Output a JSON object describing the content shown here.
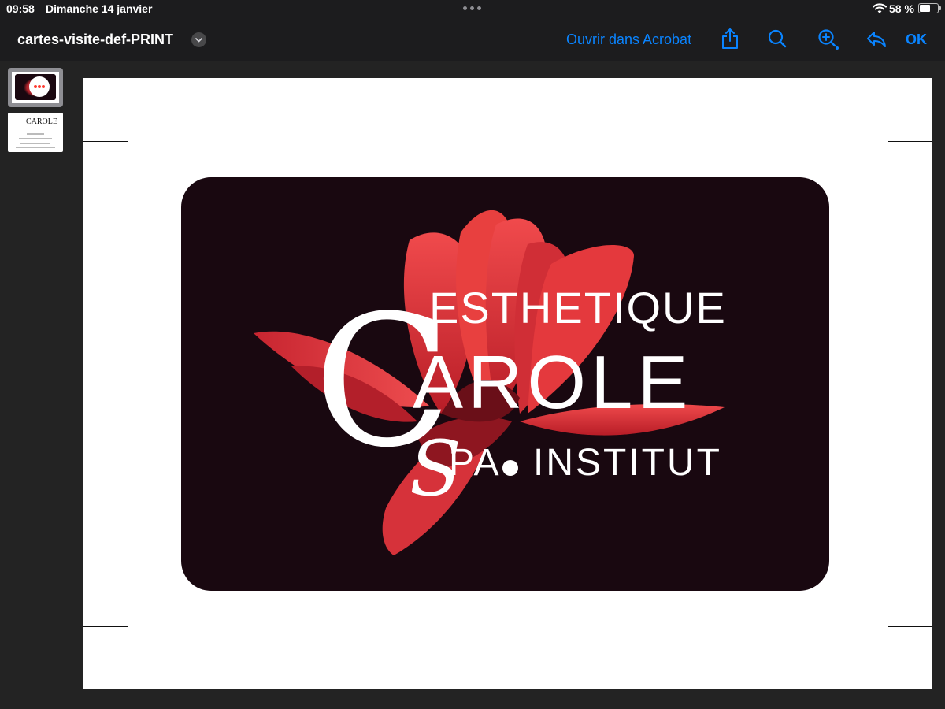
{
  "status_bar": {
    "time": "09:58",
    "date": "Dimanche 14 janvier",
    "battery_text": "58 %",
    "battery_level": 0.58
  },
  "nav": {
    "document_title": "cartes-visite-def-PRINT",
    "open_in_acrobat": "Ouvrir dans Acrobat",
    "ok_label": "OK",
    "icons": [
      "share-icon",
      "search-icon",
      "zoom-in-icon",
      "reply-icon"
    ]
  },
  "sidebar": {
    "thumbnails": [
      {
        "page": 1,
        "selected": true,
        "thumb_logo": "CAROLE"
      },
      {
        "page": 2,
        "selected": false,
        "thumb_logo": "CAROLE"
      }
    ]
  },
  "card": {
    "line1": "ESTHETIQUE",
    "initial_c": "C",
    "line2": "AROLE",
    "initial_s": "S",
    "line3a": "PA",
    "line3b": "INSTITUT",
    "background_color": "#190810",
    "flower_color": "#d8342f"
  },
  "colors": {
    "accent": "#0a84ff",
    "chrome": "#1c1c1e",
    "background": "#232323"
  }
}
